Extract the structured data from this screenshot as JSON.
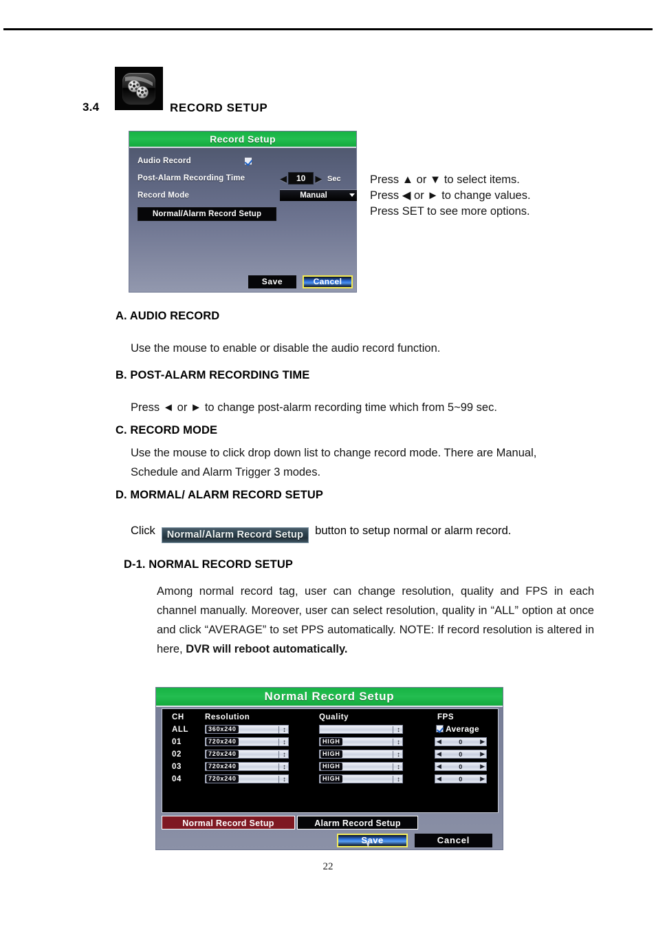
{
  "page": {
    "number": "22"
  },
  "section": {
    "number": "3.4",
    "title": "RECORD SETUP",
    "icon": "film-reel-icon"
  },
  "record_setup_dialog": {
    "title": "Record Setup",
    "fields": {
      "audio_record_label": "Audio Record",
      "audio_record_checked": "✓",
      "post_alarm_label": "Post-Alarm Recording Time",
      "post_alarm_value": "10",
      "post_alarm_unit": "Sec",
      "post_alarm_left_arrow": "◀",
      "post_alarm_right_arrow": "▶",
      "record_mode_label": "Record Mode",
      "record_mode_value": "Manual",
      "normal_alarm_button": "Normal/Alarm Record Setup"
    },
    "buttons": {
      "save": "Save",
      "cancel": "Cancel"
    }
  },
  "instructions": {
    "line1": "Press ▲ or ▼ to select items.",
    "line2": "Press ◀ or ► to change values.",
    "line3": "Press SET to see more options."
  },
  "sections": {
    "a": {
      "heading": "A. AUDIO RECORD",
      "body": "Use the mouse to enable or disable the audio record function."
    },
    "b": {
      "heading": "B. POST-ALARM RECORDING TIME",
      "body": "Press ◄ or ► to change post-alarm recording time which from 5~99 sec."
    },
    "c": {
      "heading": "C. RECORD MODE",
      "body": "Use the mouse to click drop down list to change record mode. There are Manual, Schedule and Alarm Trigger 3 modes."
    },
    "d": {
      "heading": "D. MORMAL/ ALARM RECORD SETUP",
      "click_prefix": "Click",
      "chip_label": "Normal/Alarm Record Setup",
      "click_suffix": "button to setup normal or alarm record."
    },
    "d1": {
      "heading": "D-1. NORMAL RECORD SETUP",
      "body_plain": "Among normal record tag, user can change resolution, quality and FPS in each channel manually. Moreover, user can select resolution, quality in “ALL” option at once and click “AVERAGE” to set PPS automatically. NOTE: If record resolution is altered in here, ",
      "body_bold": "DVR will reboot automatically."
    }
  },
  "normal_record_dialog": {
    "title": "Normal Record Setup",
    "columns": {
      "ch": "CH",
      "resolution": "Resolution",
      "quality": "Quality",
      "fps": "FPS"
    },
    "average_label": "Average",
    "rows": [
      {
        "ch": "ALL",
        "resolution": "360x240",
        "quality": "",
        "fps": ""
      },
      {
        "ch": "01",
        "resolution": "720x240",
        "quality": "HIGH",
        "fps": "0"
      },
      {
        "ch": "02",
        "resolution": "720x240",
        "quality": "HIGH",
        "fps": "0"
      },
      {
        "ch": "03",
        "resolution": "720x240",
        "quality": "HIGH",
        "fps": "0"
      },
      {
        "ch": "04",
        "resolution": "720x240",
        "quality": "HIGH",
        "fps": "0"
      }
    ],
    "tabs": [
      {
        "label": "Normal Record Setup",
        "active": true
      },
      {
        "label": "Alarm Record Setup",
        "active": false
      }
    ],
    "buttons": {
      "save": "Save",
      "cancel": "Cancel"
    },
    "spinner_glyph": "↕",
    "left_arrow": "◀",
    "right_arrow": "▶"
  },
  "colors": {
    "title_green": "#17b344",
    "dialog_body": "#7e849c",
    "active_tab_red": "#7e1822",
    "highlight_yellow": "#f7ef5c",
    "button_blue": "#2d72dc"
  }
}
